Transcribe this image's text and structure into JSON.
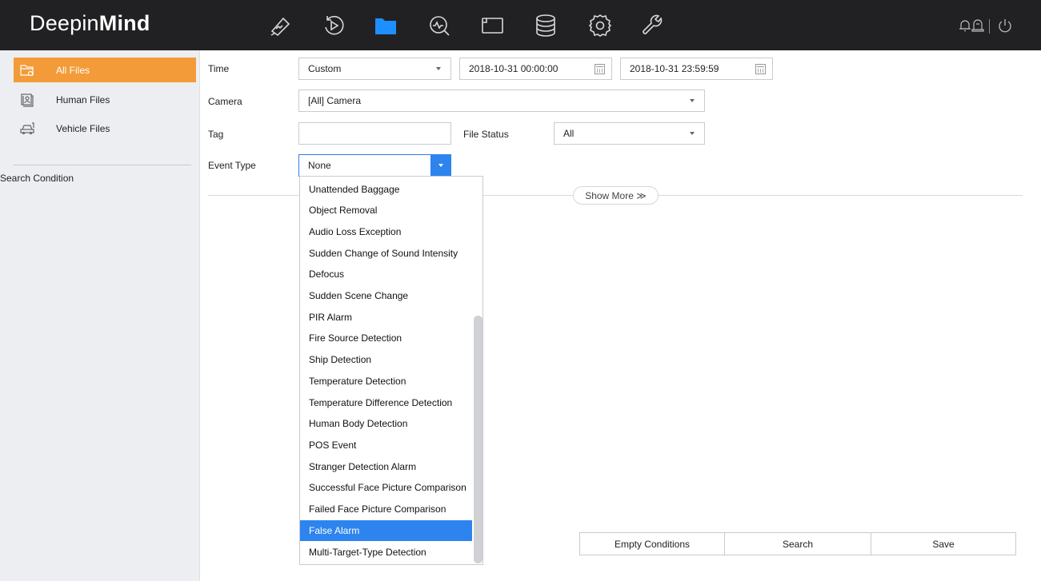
{
  "app": {
    "logo_light": "Deepin",
    "logo_bold": "Mind"
  },
  "nav_icons": [
    "live-view-icon",
    "playback-icon",
    "file-management-icon",
    "smart-analysis-icon",
    "video-wall-icon",
    "storage-icon",
    "settings-icon",
    "maintenance-icon"
  ],
  "header_icons": [
    "bell-icon",
    "alarm-icon",
    "power-icon"
  ],
  "colors": {
    "topbar": "#212123",
    "accent_orange": "#f39b39",
    "accent_blue": "#2d84ee",
    "active_nav_icon": "#1e8fff"
  },
  "sidebar": {
    "items": [
      {
        "label": "All Files",
        "icon": "folder-icon",
        "active": true
      },
      {
        "label": "Human Files",
        "icon": "human-files-icon",
        "active": false
      },
      {
        "label": "Vehicle Files",
        "icon": "vehicle-files-icon",
        "active": false
      }
    ],
    "search_condition": "Search Condition"
  },
  "form": {
    "time_label": "Time",
    "time_mode": "Custom",
    "start_time": "2018-10-31 00:00:00",
    "end_time": "2018-10-31 23:59:59",
    "camera_label": "Camera",
    "camera_value": "[All] Camera",
    "tag_label": "Tag",
    "tag_value": "",
    "file_status_label": "File Status",
    "file_status_value": "All",
    "event_type_label": "Event Type",
    "event_type_value": "None",
    "show_more": "Show More ≫"
  },
  "event_type_options": [
    "Unattended Baggage",
    "Object Removal",
    "Audio Loss Exception",
    "Sudden Change of Sound Intensity",
    "Defocus",
    "Sudden Scene Change",
    "PIR Alarm",
    "Fire Source Detection",
    "Ship Detection",
    "Temperature Detection",
    "Temperature Difference Detection",
    "Human Body Detection",
    "POS Event",
    "Stranger Detection Alarm",
    "Successful Face Picture Comparison",
    "Failed Face Picture Comparison",
    "False Alarm",
    "Multi-Target-Type Detection"
  ],
  "highlighted_option": "False Alarm",
  "actions": {
    "empty": "Empty Conditions",
    "search": "Search",
    "save": "Save"
  }
}
